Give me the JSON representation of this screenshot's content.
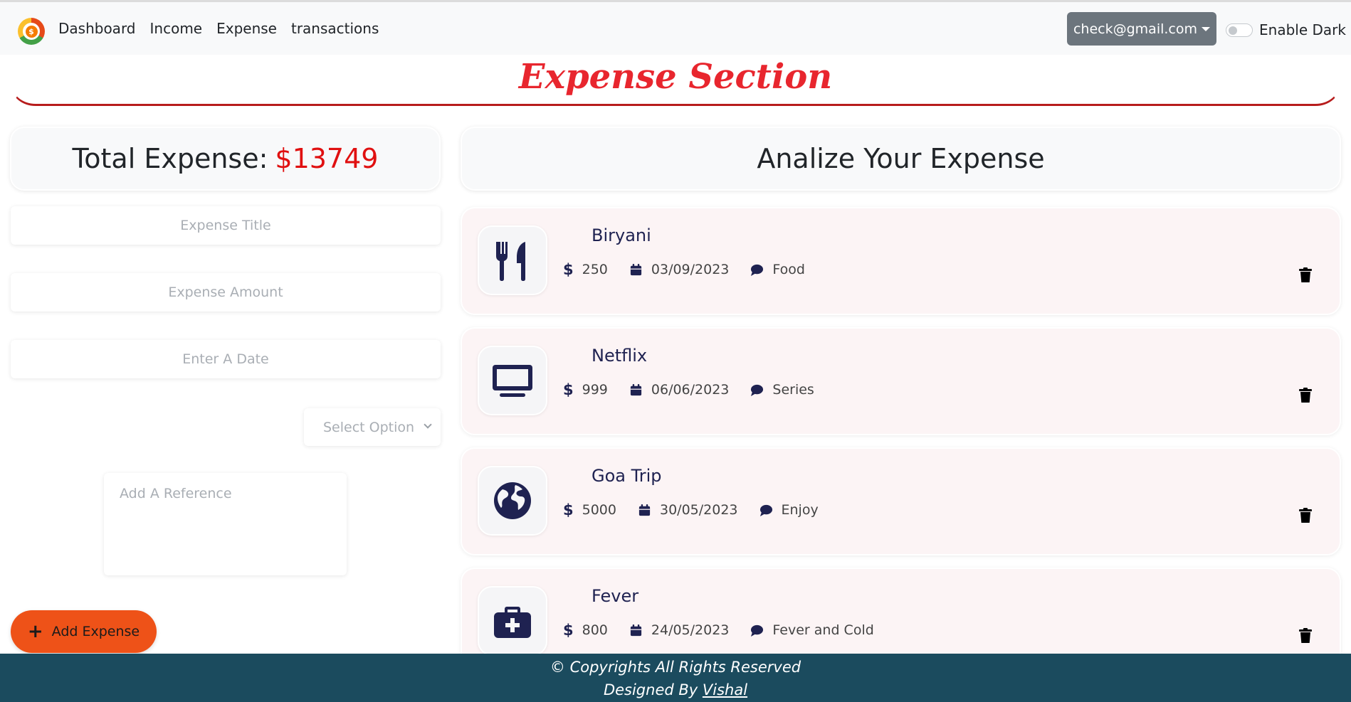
{
  "nav": {
    "links": [
      "Dashboard",
      "Income",
      "Expense",
      "transactions"
    ],
    "user_email": "check@gmail.com",
    "dark_toggle_label": "Enable Dark",
    "dark_enabled": false
  },
  "section_title": "Expense Section",
  "total": {
    "label": "Total Expense:",
    "amount": "$13749"
  },
  "form": {
    "title_placeholder": "Expense Title",
    "amount_placeholder": "Expense Amount",
    "date_placeholder": "Enter A Date",
    "select_label": "Select Option",
    "reference_placeholder": "Add A Reference",
    "add_button_label": "Add Expense"
  },
  "analyze_title": "Analize Your Expense",
  "expenses": [
    {
      "title": "Biryani",
      "amount": "250",
      "date": "03/09/2023",
      "category": "Food",
      "icon": "utensils-icon"
    },
    {
      "title": "Netflix",
      "amount": "999",
      "date": "06/06/2023",
      "category": "Series",
      "icon": "tv-icon"
    },
    {
      "title": "Goa Trip",
      "amount": "5000",
      "date": "30/05/2023",
      "category": "Enjoy",
      "icon": "globe-icon"
    },
    {
      "title": "Fever",
      "amount": "800",
      "date": "24/05/2023",
      "category": "Fever and Cold",
      "icon": "medical-kit-icon"
    }
  ],
  "footer": {
    "copyright": "© Copyrights All Rights Reserved",
    "designed_by": "Designed By",
    "author": "Vishal"
  },
  "colors": {
    "title_red": "#e8262e",
    "total_red": "#e01010",
    "add_button": "#ee5218",
    "footer_bg": "#1b4b5e",
    "icon_navy": "#1f2251",
    "user_button": "#6c757d"
  }
}
